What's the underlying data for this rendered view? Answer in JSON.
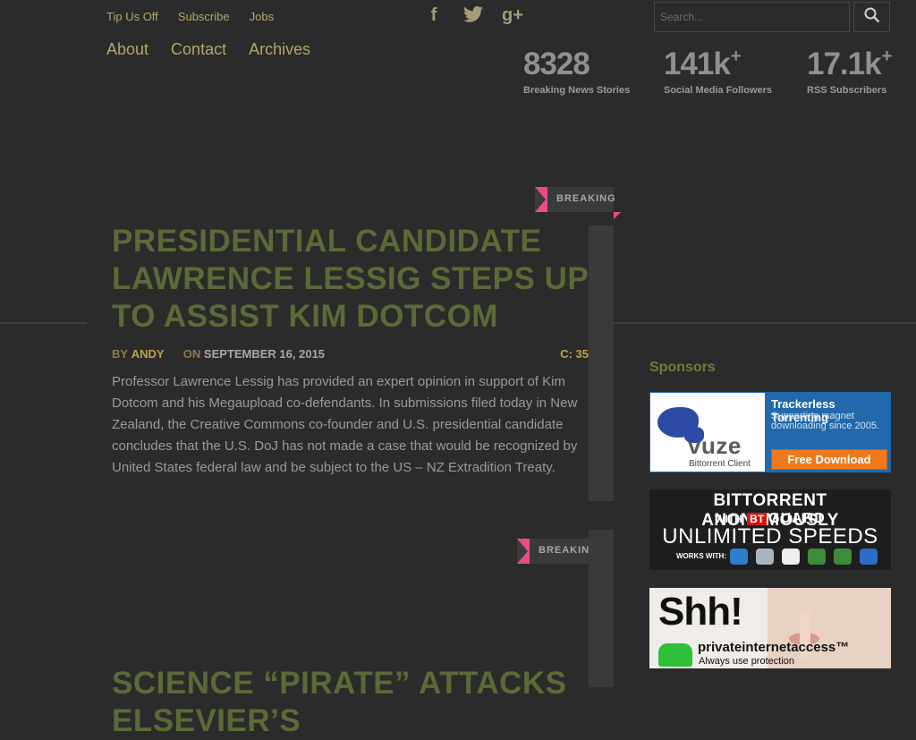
{
  "top_links": [
    "Tip Us Off",
    "Subscribe",
    "Jobs"
  ],
  "social": [
    {
      "icon": "facebook-icon",
      "glyph": "f"
    },
    {
      "icon": "twitter-icon",
      "glyph": "🐦"
    },
    {
      "icon": "google-plus-icon",
      "glyph": "g+"
    }
  ],
  "search": {
    "placeholder": "Search..."
  },
  "nav": [
    "About",
    "Contact",
    "Archives"
  ],
  "stats": [
    {
      "value": "8328",
      "plus": "",
      "label": "Breaking News Stories"
    },
    {
      "value": "141k",
      "plus": "+",
      "label": "Social Media Followers"
    },
    {
      "value": "17.1k",
      "plus": "+",
      "label": "RSS Subscribers"
    }
  ],
  "articles": [
    {
      "category": "BREAKING",
      "title": "Presidential Candidate Lawrence Lessig Steps Up to Assist Kim Dotcom",
      "by_label": "BY",
      "author": "ANDY",
      "on_label": "ON",
      "date": "SEPTEMBER 16, 2015",
      "comments_label": "C:",
      "comments": "35",
      "excerpt": "Professor Lawrence Lessig has provided an expert opinion in support of Kim Dotcom and his Megaupload co-defendants. In submissions filed today in New Zealand, the Creative Commons co-founder and U.S. presidential candidate concludes that the U.S. DoJ has not made a case that would be recognized by United States federal law and be subject to the US – NZ Extradition Treaty."
    },
    {
      "category": "BREAKING",
      "title": "Science “Pirate” Attacks Elsevier’s"
    }
  ],
  "sidebar": {
    "heading": "Sponsors",
    "ads": [
      {
        "brand": "vuze",
        "brand_sub": "Bittorrent Client",
        "headline": "Trackerless Torrenting",
        "sub": "Supporting magnet downloading since 2005.",
        "cta": "Free Download"
      },
      {
        "line1": "BITTORRENT ANONYMOUSLY",
        "with": "WITH",
        "bt": "BT",
        "guard": "GUARD",
        "line3": "UNLIMITED SPEEDS",
        "works": "WORKS WITH:"
      },
      {
        "shh": "Shh!",
        "brand": "privateinternetaccess™",
        "tagline": "Always use protection"
      }
    ]
  },
  "colors": {
    "background": "#2b2b2b",
    "link_gold": "#b3a76a",
    "title_olive": "#5b6a36",
    "accent_pink": "#ec4a8c"
  }
}
